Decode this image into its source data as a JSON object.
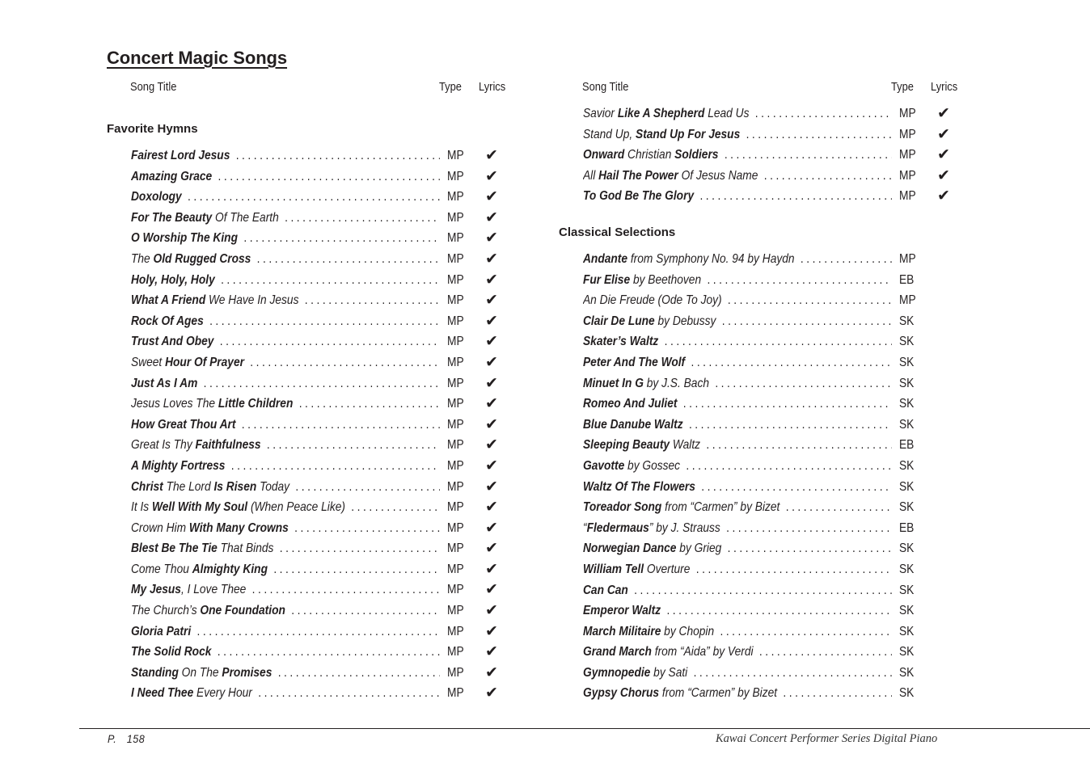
{
  "page_title": "Concert Magic Songs",
  "columns_header": {
    "song_title": "Song Title",
    "type": "Type",
    "lyrics": "Lyrics"
  },
  "lyrics_check_symbol": "✔",
  "left_column": {
    "sections": [
      {
        "title": "Favorite Hymns",
        "songs": [
          {
            "parts": [
              {
                "t": "Fairest Lord Jesus",
                "b": true
              }
            ],
            "type": "MP",
            "lyrics": true
          },
          {
            "parts": [
              {
                "t": "Amazing Grace",
                "b": true
              }
            ],
            "type": "MP",
            "lyrics": true
          },
          {
            "parts": [
              {
                "t": "Doxology",
                "b": true
              }
            ],
            "type": "MP",
            "lyrics": true
          },
          {
            "parts": [
              {
                "t": "For The Beauty",
                "b": true
              },
              {
                "t": " Of The Earth",
                "b": false
              }
            ],
            "type": "MP",
            "lyrics": true
          },
          {
            "parts": [
              {
                "t": "O Worship The King",
                "b": true
              }
            ],
            "type": "MP",
            "lyrics": true
          },
          {
            "parts": [
              {
                "t": "The ",
                "b": false
              },
              {
                "t": "Old Rugged Cross",
                "b": true
              }
            ],
            "type": "MP",
            "lyrics": true
          },
          {
            "parts": [
              {
                "t": "Holy, Holy, Holy",
                "b": true
              }
            ],
            "type": "MP",
            "lyrics": true
          },
          {
            "parts": [
              {
                "t": "What A Friend",
                "b": true
              },
              {
                "t": " We Have In Jesus",
                "b": false
              }
            ],
            "type": "MP",
            "lyrics": true
          },
          {
            "parts": [
              {
                "t": "Rock Of Ages",
                "b": true
              }
            ],
            "type": "MP",
            "lyrics": true
          },
          {
            "parts": [
              {
                "t": "Trust And Obey",
                "b": true
              }
            ],
            "type": "MP",
            "lyrics": true
          },
          {
            "parts": [
              {
                "t": "Sweet ",
                "b": false
              },
              {
                "t": "Hour Of Prayer",
                "b": true
              }
            ],
            "type": "MP",
            "lyrics": true
          },
          {
            "parts": [
              {
                "t": "Just As I Am",
                "b": true
              }
            ],
            "type": "MP",
            "lyrics": true
          },
          {
            "parts": [
              {
                "t": "Jesus Loves The ",
                "b": false
              },
              {
                "t": "Little Children",
                "b": true
              }
            ],
            "type": "MP",
            "lyrics": true
          },
          {
            "parts": [
              {
                "t": "How Great Thou Art",
                "b": true
              }
            ],
            "type": "MP",
            "lyrics": true
          },
          {
            "parts": [
              {
                "t": "Great Is Thy ",
                "b": false
              },
              {
                "t": "Faithfulness",
                "b": true
              }
            ],
            "type": "MP",
            "lyrics": true
          },
          {
            "parts": [
              {
                "t": "A Mighty Fortress",
                "b": true
              }
            ],
            "type": "MP",
            "lyrics": true
          },
          {
            "parts": [
              {
                "t": "Christ",
                "b": true
              },
              {
                "t": " The Lord ",
                "b": false
              },
              {
                "t": "Is Risen",
                "b": true
              },
              {
                "t": " Today",
                "b": false
              }
            ],
            "type": "MP",
            "lyrics": true
          },
          {
            "parts": [
              {
                "t": "It Is ",
                "b": false
              },
              {
                "t": "Well With My Soul",
                "b": true
              },
              {
                "t": " (When Peace Like)",
                "b": false
              }
            ],
            "type": "MP",
            "lyrics": true
          },
          {
            "parts": [
              {
                "t": "Crown Him ",
                "b": false
              },
              {
                "t": "With Many Crowns",
                "b": true
              }
            ],
            "type": "MP",
            "lyrics": true
          },
          {
            "parts": [
              {
                "t": "Blest Be The Tie",
                "b": true
              },
              {
                "t": " That Binds",
                "b": false
              }
            ],
            "type": "MP",
            "lyrics": true
          },
          {
            "parts": [
              {
                "t": "Come Thou ",
                "b": false
              },
              {
                "t": "Almighty King",
                "b": true
              }
            ],
            "type": "MP",
            "lyrics": true
          },
          {
            "parts": [
              {
                "t": "My Jesus",
                "b": true
              },
              {
                "t": ", I Love Thee",
                "b": false
              }
            ],
            "type": "MP",
            "lyrics": true
          },
          {
            "parts": [
              {
                "t": "The Church’s ",
                "b": false
              },
              {
                "t": "One Foundation",
                "b": true
              }
            ],
            "type": "MP",
            "lyrics": true
          },
          {
            "parts": [
              {
                "t": "Gloria Patri",
                "b": true
              }
            ],
            "type": "MP",
            "lyrics": true
          },
          {
            "parts": [
              {
                "t": "The Solid Rock",
                "b": true
              }
            ],
            "type": "MP",
            "lyrics": true
          },
          {
            "parts": [
              {
                "t": "Standing",
                "b": true
              },
              {
                "t": " On The ",
                "b": false
              },
              {
                "t": "Promises",
                "b": true
              }
            ],
            "type": "MP",
            "lyrics": true
          },
          {
            "parts": [
              {
                "t": "I Need Thee",
                "b": true
              },
              {
                "t": " Every Hour",
                "b": false
              }
            ],
            "type": "MP",
            "lyrics": true
          }
        ]
      }
    ]
  },
  "right_column": {
    "continued_songs": [
      {
        "parts": [
          {
            "t": "Savior ",
            "b": false
          },
          {
            "t": "Like A Shepherd",
            "b": true
          },
          {
            "t": " Lead Us",
            "b": false
          }
        ],
        "type": "MP",
        "lyrics": true
      },
      {
        "parts": [
          {
            "t": "Stand Up, ",
            "b": false
          },
          {
            "t": "Stand Up For Jesus",
            "b": true
          }
        ],
        "type": "MP",
        "lyrics": true
      },
      {
        "parts": [
          {
            "t": "Onward",
            "b": true
          },
          {
            "t": " Christian ",
            "b": false
          },
          {
            "t": "Soldiers",
            "b": true
          }
        ],
        "type": "MP",
        "lyrics": true
      },
      {
        "parts": [
          {
            "t": "All ",
            "b": false
          },
          {
            "t": "Hail The Power",
            "b": true
          },
          {
            "t": " Of Jesus Name",
            "b": false
          }
        ],
        "type": "MP",
        "lyrics": true
      },
      {
        "parts": [
          {
            "t": "To God Be The Glory",
            "b": true
          }
        ],
        "type": "MP",
        "lyrics": true
      }
    ],
    "sections": [
      {
        "title": "Classical Selections",
        "songs": [
          {
            "parts": [
              {
                "t": "Andante",
                "b": true
              },
              {
                "t": " from Symphony No. 94 by Haydn",
                "b": false
              }
            ],
            "type": "MP",
            "lyrics": false
          },
          {
            "parts": [
              {
                "t": "Fur Elise",
                "b": true
              },
              {
                "t": " by Beethoven",
                "b": false
              }
            ],
            "type": "EB",
            "lyrics": false
          },
          {
            "parts": [
              {
                "t": "An Die Freude (Ode To Joy)",
                "b": false
              }
            ],
            "type": "MP",
            "lyrics": false
          },
          {
            "parts": [
              {
                "t": "Clair De Lune",
                "b": true
              },
              {
                "t": " by Debussy",
                "b": false
              }
            ],
            "type": "SK",
            "lyrics": false
          },
          {
            "parts": [
              {
                "t": "Skater’s Waltz",
                "b": true
              }
            ],
            "type": "SK",
            "lyrics": false
          },
          {
            "parts": [
              {
                "t": "Peter And The Wolf",
                "b": true
              }
            ],
            "type": "SK",
            "lyrics": false
          },
          {
            "parts": [
              {
                "t": "Minuet In G",
                "b": true
              },
              {
                "t": " by J.S. Bach",
                "b": false
              }
            ],
            "type": "SK",
            "lyrics": false
          },
          {
            "parts": [
              {
                "t": "Romeo And Juliet",
                "b": true
              }
            ],
            "type": "SK",
            "lyrics": false
          },
          {
            "parts": [
              {
                "t": "Blue Danube Waltz",
                "b": true
              }
            ],
            "type": "SK",
            "lyrics": false
          },
          {
            "parts": [
              {
                "t": "Sleeping Beauty",
                "b": true
              },
              {
                "t": " Waltz",
                "b": false
              }
            ],
            "type": "EB",
            "lyrics": false
          },
          {
            "parts": [
              {
                "t": "Gavotte",
                "b": true
              },
              {
                "t": " by Gossec",
                "b": false
              }
            ],
            "type": "SK",
            "lyrics": false
          },
          {
            "parts": [
              {
                "t": "Waltz Of The Flowers",
                "b": true
              }
            ],
            "type": "SK",
            "lyrics": false
          },
          {
            "parts": [
              {
                "t": "Toreador Song",
                "b": true
              },
              {
                "t": " from “Carmen” by Bizet",
                "b": false
              }
            ],
            "type": "SK",
            "lyrics": false
          },
          {
            "parts": [
              {
                "t": "“",
                "b": false
              },
              {
                "t": "Fledermaus",
                "b": true
              },
              {
                "t": "” by J. Strauss",
                "b": false
              }
            ],
            "type": "EB",
            "lyrics": false
          },
          {
            "parts": [
              {
                "t": "Norwegian Dance",
                "b": true
              },
              {
                "t": " by Grieg",
                "b": false
              }
            ],
            "type": "SK",
            "lyrics": false
          },
          {
            "parts": [
              {
                "t": "William Tell",
                "b": true
              },
              {
                "t": " Overture",
                "b": false
              }
            ],
            "type": "SK",
            "lyrics": false
          },
          {
            "parts": [
              {
                "t": "Can Can",
                "b": true
              }
            ],
            "type": "SK",
            "lyrics": false
          },
          {
            "parts": [
              {
                "t": "Emperor Waltz",
                "b": true
              }
            ],
            "type": "SK",
            "lyrics": false
          },
          {
            "parts": [
              {
                "t": "March Militaire",
                "b": true
              },
              {
                "t": " by Chopin",
                "b": false
              }
            ],
            "type": "SK",
            "lyrics": false
          },
          {
            "parts": [
              {
                "t": "Grand March",
                "b": true
              },
              {
                "t": " from “Aida” by Verdi",
                "b": false
              }
            ],
            "type": "SK",
            "lyrics": false
          },
          {
            "parts": [
              {
                "t": "Gymnopedie",
                "b": true
              },
              {
                "t": " by Sati",
                "b": false
              }
            ],
            "type": "SK",
            "lyrics": false
          },
          {
            "parts": [
              {
                "t": "Gypsy Chorus",
                "b": true
              },
              {
                "t": " from “Carmen” by Bizet",
                "b": false
              }
            ],
            "type": "SK",
            "lyrics": false
          }
        ]
      }
    ]
  },
  "footer": {
    "page_prefix": "P.",
    "page_number": "158",
    "brand": "Kawai Concert Performer Series Digital Piano"
  }
}
